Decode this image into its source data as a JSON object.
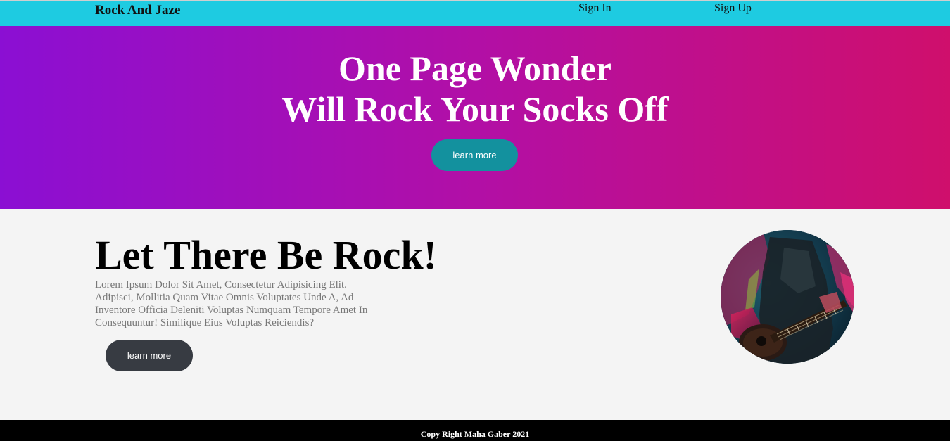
{
  "navbar": {
    "brand": "Rock And Jaze",
    "links": [
      {
        "label": "Sign In"
      },
      {
        "label": "Sign Up"
      }
    ],
    "background": "#1ecbe1"
  },
  "hero": {
    "title_line1": "One Page Wonder",
    "title_line2": "Will Rock Your Socks Off",
    "button_label": "learn more",
    "gradient_start": "#8b0fd3",
    "gradient_end": "#cf0f6c",
    "button_color": "#13919e"
  },
  "content": {
    "title": "Let There Be Rock!",
    "text": "Lorem Ipsum Dolor Sit Amet, Consectetur Adipisicing Elit. Adipisci, Mollitia Quam Vitae Omnis Voluptates Unde A, Ad Inventore Officia Deleniti Voluptas Numquam Tempore Amet In Consequuntur! Similique Eius Voluptas Reiciendis?",
    "button_label": "learn more",
    "button_color": "#373b42",
    "image_icon": "guitar-player-photo"
  },
  "footer": {
    "text": "Copy Right Maha Gaber 2021"
  }
}
